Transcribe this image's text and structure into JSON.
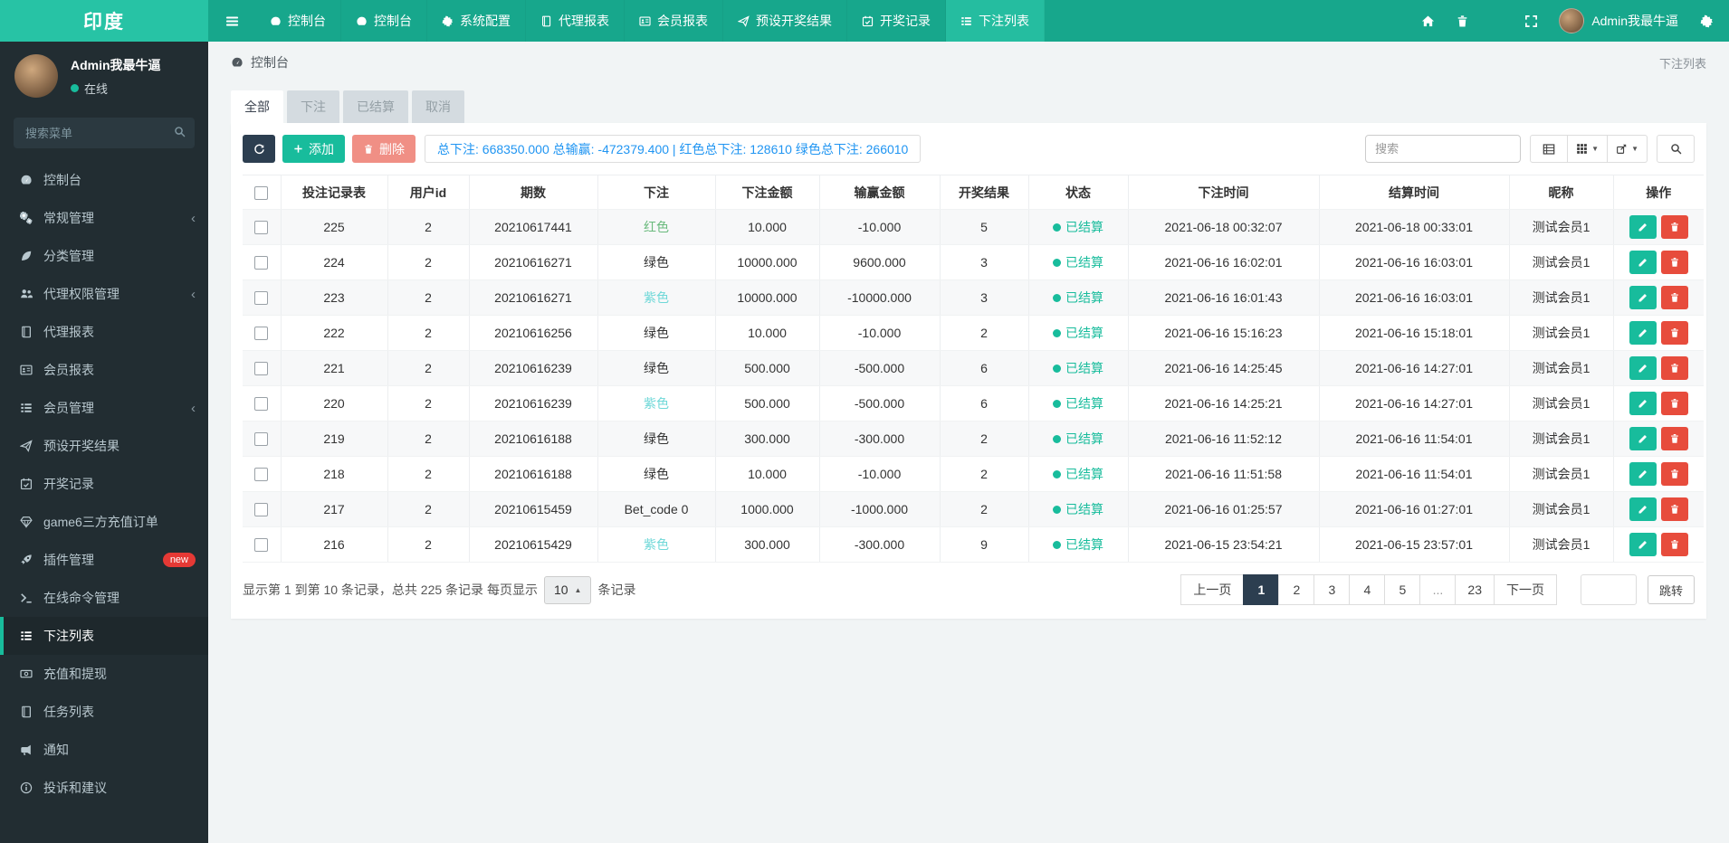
{
  "topbar": {
    "logo": "印度",
    "nav": [
      {
        "label": "控制台",
        "icon": "gauge-icon"
      },
      {
        "label": "控制台",
        "icon": "gauge-icon"
      },
      {
        "label": "系统配置",
        "icon": "gear-icon"
      },
      {
        "label": "代理报表",
        "icon": "book-icon"
      },
      {
        "label": "会员报表",
        "icon": "idcard-icon"
      },
      {
        "label": "预设开奖结果",
        "icon": "send-icon"
      },
      {
        "label": "开奖记录",
        "icon": "calendar-icon"
      },
      {
        "label": "下注列表",
        "icon": "list-icon",
        "active": true
      }
    ],
    "right_icons": [
      {
        "name": "home-icon"
      },
      {
        "name": "trash-icon"
      },
      {
        "name": "refresh-icon"
      },
      {
        "name": "expand-icon"
      }
    ],
    "user": "Admin我最牛逼"
  },
  "sidebar": {
    "user": {
      "name": "Admin我最牛逼",
      "status": "在线"
    },
    "search_placeholder": "搜索菜单",
    "items": [
      {
        "label": "控制台",
        "icon": "gauge-icon"
      },
      {
        "label": "常规管理",
        "icon": "gears-icon",
        "chevron": true
      },
      {
        "label": "分类管理",
        "icon": "leaf-icon"
      },
      {
        "label": "代理权限管理",
        "icon": "users-icon",
        "chevron": true
      },
      {
        "label": "代理报表",
        "icon": "book-icon"
      },
      {
        "label": "会员报表",
        "icon": "idcard-icon"
      },
      {
        "label": "会员管理",
        "icon": "list-icon",
        "chevron": true
      },
      {
        "label": "预设开奖结果",
        "icon": "send-icon"
      },
      {
        "label": "开奖记录",
        "icon": "calendar-icon"
      },
      {
        "label": "game6三方充值订单",
        "icon": "gem-icon"
      },
      {
        "label": "插件管理",
        "icon": "rocket-icon",
        "badge": "new"
      },
      {
        "label": "在线命令管理",
        "icon": "terminal-icon"
      },
      {
        "label": "下注列表",
        "icon": "list-icon",
        "active": true
      },
      {
        "label": "充值和提现",
        "icon": "money-icon"
      },
      {
        "label": "任务列表",
        "icon": "book-icon"
      },
      {
        "label": "通知",
        "icon": "bullhorn-icon"
      },
      {
        "label": "投诉和建议",
        "icon": "info-icon"
      }
    ]
  },
  "content": {
    "breadcrumb": "控制台",
    "page_title": "下注列表",
    "tabs": [
      {
        "label": "全部",
        "active": true
      },
      {
        "label": "下注"
      },
      {
        "label": "已结算"
      },
      {
        "label": "取消"
      }
    ],
    "toolbar": {
      "add_label": "添加",
      "delete_label": "删除",
      "stats": "总下注: 668350.000 总输赢: -472379.400 | 红色总下注: 128610 绿色总下注: 266010",
      "search_placeholder": "搜索"
    }
  },
  "table": {
    "columns": [
      "投注记录表",
      "用户id",
      "期数",
      "下注",
      "下注金额",
      "输赢金额",
      "开奖结果",
      "状态",
      "下注时间",
      "结算时间",
      "昵称",
      "操作"
    ],
    "rows": [
      {
        "id": "225",
        "uid": "2",
        "period": "20210617441",
        "bet": "红色",
        "bet_class": "green",
        "amount": "10.000",
        "winlose": "-10.000",
        "result": "5",
        "status": "已结算",
        "bet_time": "2021-06-18 00:32:07",
        "settle_time": "2021-06-18 00:33:01",
        "nickname": "测试会员1"
      },
      {
        "id": "224",
        "uid": "2",
        "period": "20210616271",
        "bet": "绿色",
        "bet_class": "dark",
        "amount": "10000.000",
        "winlose": "9600.000",
        "result": "3",
        "status": "已结算",
        "bet_time": "2021-06-16 16:02:01",
        "settle_time": "2021-06-16 16:03:01",
        "nickname": "测试会员1"
      },
      {
        "id": "223",
        "uid": "2",
        "period": "20210616271",
        "bet": "紫色",
        "bet_class": "cyan",
        "amount": "10000.000",
        "winlose": "-10000.000",
        "result": "3",
        "status": "已结算",
        "bet_time": "2021-06-16 16:01:43",
        "settle_time": "2021-06-16 16:03:01",
        "nickname": "测试会员1"
      },
      {
        "id": "222",
        "uid": "2",
        "period": "20210616256",
        "bet": "绿色",
        "bet_class": "dark",
        "amount": "10.000",
        "winlose": "-10.000",
        "result": "2",
        "status": "已结算",
        "bet_time": "2021-06-16 15:16:23",
        "settle_time": "2021-06-16 15:18:01",
        "nickname": "测试会员1"
      },
      {
        "id": "221",
        "uid": "2",
        "period": "20210616239",
        "bet": "绿色",
        "bet_class": "dark",
        "amount": "500.000",
        "winlose": "-500.000",
        "result": "6",
        "status": "已结算",
        "bet_time": "2021-06-16 14:25:45",
        "settle_time": "2021-06-16 14:27:01",
        "nickname": "测试会员1"
      },
      {
        "id": "220",
        "uid": "2",
        "period": "20210616239",
        "bet": "紫色",
        "bet_class": "cyan",
        "amount": "500.000",
        "winlose": "-500.000",
        "result": "6",
        "status": "已结算",
        "bet_time": "2021-06-16 14:25:21",
        "settle_time": "2021-06-16 14:27:01",
        "nickname": "测试会员1"
      },
      {
        "id": "219",
        "uid": "2",
        "period": "20210616188",
        "bet": "绿色",
        "bet_class": "dark",
        "amount": "300.000",
        "winlose": "-300.000",
        "result": "2",
        "status": "已结算",
        "bet_time": "2021-06-16 11:52:12",
        "settle_time": "2021-06-16 11:54:01",
        "nickname": "测试会员1"
      },
      {
        "id": "218",
        "uid": "2",
        "period": "20210616188",
        "bet": "绿色",
        "bet_class": "dark",
        "amount": "10.000",
        "winlose": "-10.000",
        "result": "2",
        "status": "已结算",
        "bet_time": "2021-06-16 11:51:58",
        "settle_time": "2021-06-16 11:54:01",
        "nickname": "测试会员1"
      },
      {
        "id": "217",
        "uid": "2",
        "period": "20210615459",
        "bet": "Bet_code 0",
        "bet_class": "dark",
        "amount": "1000.000",
        "winlose": "-1000.000",
        "result": "2",
        "status": "已结算",
        "bet_time": "2021-06-16 01:25:57",
        "settle_time": "2021-06-16 01:27:01",
        "nickname": "测试会员1"
      },
      {
        "id": "216",
        "uid": "2",
        "period": "20210615429",
        "bet": "紫色",
        "bet_class": "cyan",
        "amount": "300.000",
        "winlose": "-300.000",
        "result": "9",
        "status": "已结算",
        "bet_time": "2021-06-15 23:54:21",
        "settle_time": "2021-06-15 23:57:01",
        "nickname": "测试会员1"
      }
    ]
  },
  "pagination": {
    "summary_prefix": "显示第 1 到第 10 条记录，总共 225 条记录 每页显示",
    "page_size": "10",
    "summary_suffix": "条记录",
    "pages": [
      {
        "label": "上一页"
      },
      {
        "label": "1",
        "active": true
      },
      {
        "label": "2"
      },
      {
        "label": "3"
      },
      {
        "label": "4"
      },
      {
        "label": "5"
      },
      {
        "label": "...",
        "ellipsis": true
      },
      {
        "label": "23"
      },
      {
        "label": "下一页"
      }
    ],
    "jump_label": "跳转"
  },
  "colors": {
    "accent_teal": "#18bc9c",
    "topbar": "#17a78c",
    "sidebar": "#222d32",
    "stats_blue": "#2095f2",
    "danger_red": "#e74c3c",
    "pager_active": "#2c3e50"
  }
}
